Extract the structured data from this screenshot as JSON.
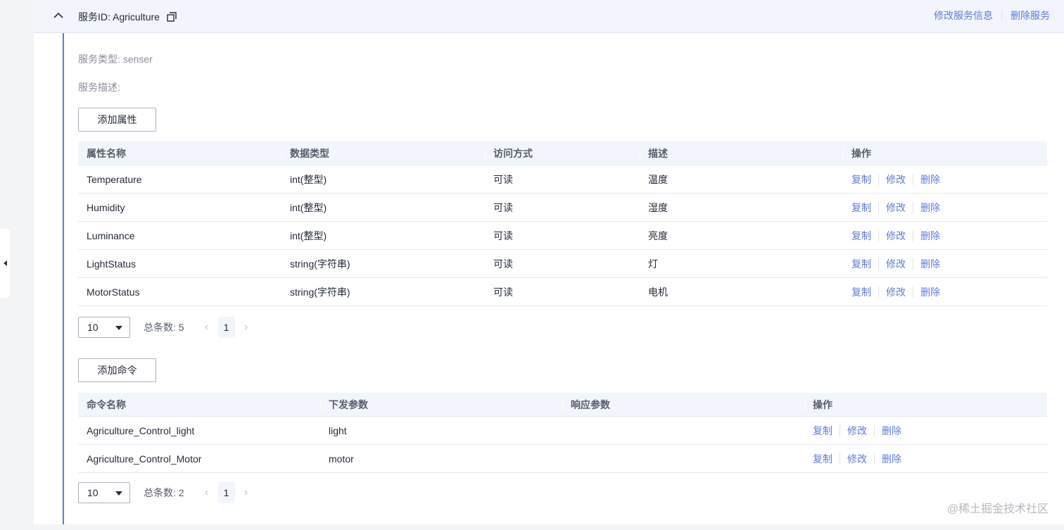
{
  "header": {
    "service_title": "服务ID: Agriculture",
    "edit_service": "修改服务信息",
    "delete_service": "删除服务"
  },
  "meta": {
    "service_type": "服务类型: senser",
    "service_desc": "服务描述:"
  },
  "properties": {
    "add_button": "添加属性",
    "columns": [
      "属性名称",
      "数据类型",
      "访问方式",
      "描述",
      "操作"
    ],
    "rows": [
      {
        "name": "Temperature",
        "type": "int(整型)",
        "access": "可读",
        "desc": "温度"
      },
      {
        "name": "Humidity",
        "type": "int(整型)",
        "access": "可读",
        "desc": "湿度"
      },
      {
        "name": "Luminance",
        "type": "int(整型)",
        "access": "可读",
        "desc": "亮度"
      },
      {
        "name": "LightStatus",
        "type": "string(字符串)",
        "access": "可读",
        "desc": "灯"
      },
      {
        "name": "MotorStatus",
        "type": "string(字符串)",
        "access": "可读",
        "desc": "电机"
      }
    ],
    "pager": {
      "page_size": "10",
      "total": "总条数: 5",
      "current_page": "1"
    }
  },
  "commands": {
    "add_button": "添加命令",
    "columns": [
      "命令名称",
      "下发参数",
      "响应参数",
      "操作"
    ],
    "rows": [
      {
        "name": "Agriculture_Control_light",
        "params": "light",
        "response": ""
      },
      {
        "name": "Agriculture_Control_Motor",
        "params": "motor",
        "response": ""
      }
    ],
    "pager": {
      "page_size": "10",
      "total": "总条数: 2",
      "current_page": "1"
    }
  },
  "ops": {
    "copy": "复制",
    "edit": "修改",
    "delete": "删除"
  },
  "pager_icons": {
    "prev": "chevron-left-icon",
    "next": "chevron-right-icon"
  },
  "watermark": "@稀土掘金技术社区",
  "colors": {
    "accent": "#5e7ce0",
    "header_bg": "#f2f5fc",
    "border": "#e4e7ef"
  }
}
